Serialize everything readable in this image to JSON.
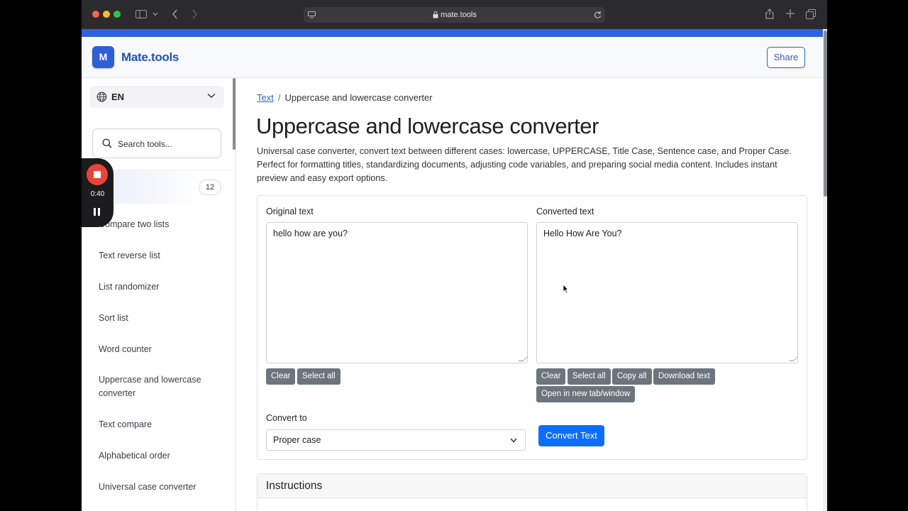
{
  "browser": {
    "url": "mate.tools",
    "traffic_colors": [
      "#ff5f57",
      "#febc2e",
      "#28c840"
    ]
  },
  "header": {
    "logo_letter": "M",
    "brand": "Mate.tools",
    "share_label": "Share"
  },
  "sidebar": {
    "language": "EN",
    "search_placeholder": "Search tools...",
    "category_count": "12",
    "items": [
      {
        "label": "Compare two lists"
      },
      {
        "label": "Text reverse list"
      },
      {
        "label": "List randomizer"
      },
      {
        "label": "Sort list"
      },
      {
        "label": "Word counter"
      },
      {
        "label": "Uppercase and lowercase converter"
      },
      {
        "label": "Text compare"
      },
      {
        "label": "Alphabetical order"
      },
      {
        "label": "Universal case converter"
      }
    ]
  },
  "recorder": {
    "time": "0:40"
  },
  "main": {
    "breadcrumb": {
      "parent": "Text",
      "separator": "/",
      "current": "Uppercase and lowercase converter"
    },
    "title": "Uppercase and lowercase converter",
    "description": "Universal case converter, convert text between different cases: lowercase, UPPERCASE, Title Case, Sentence case, and Proper Case. Perfect for formatting titles, standardizing documents, adjusting code variables, and preparing social media content. Includes instant preview and easy export options.",
    "original": {
      "label": "Original text",
      "value": "hello how are you?",
      "buttons": {
        "clear": "Clear",
        "select_all": "Select all"
      }
    },
    "converted": {
      "label": "Converted text",
      "value": "Hello How Are You?",
      "buttons": {
        "clear": "Clear",
        "select_all": "Select all",
        "copy_all": "Copy all",
        "download": "Download text",
        "open_new": "Open in new tab/window"
      }
    },
    "convert_to": {
      "label": "Convert to",
      "selected": "Proper case",
      "button": "Convert Text"
    },
    "instructions_title": "Instructions"
  }
}
